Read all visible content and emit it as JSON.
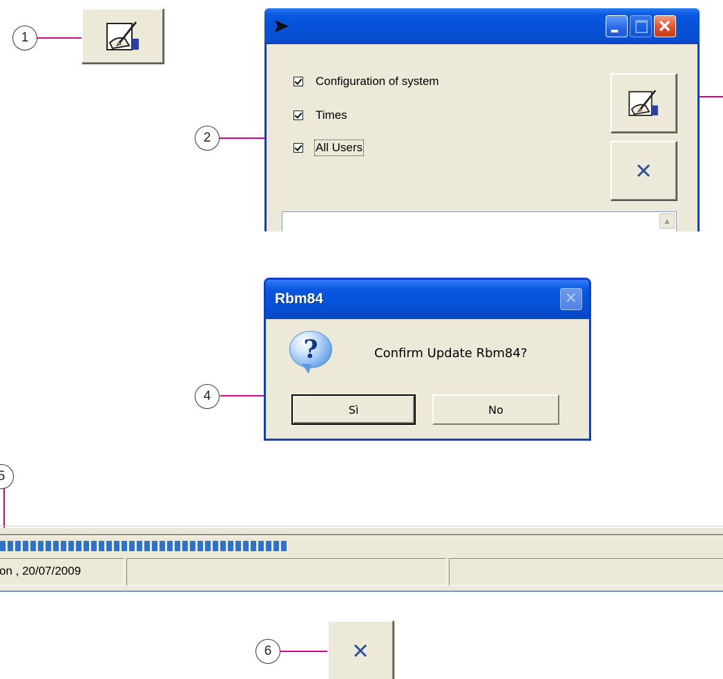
{
  "callouts": {
    "c1": "1",
    "c2": "2",
    "c4": "4",
    "c5": "5",
    "c6": "6"
  },
  "top_dialog": {
    "checkboxes": [
      {
        "label": "Configuration of system",
        "checked": true
      },
      {
        "label": "Times",
        "checked": true
      },
      {
        "label": "All Users",
        "checked": true
      }
    ],
    "buttons": {
      "write_icon": "write-icon",
      "cancel_icon": "cancel-x-icon"
    }
  },
  "confirm_dialog": {
    "title": "Rbm84",
    "message": "Confirm Update Rbm84?",
    "yes_label": "Sì",
    "no_label": "No"
  },
  "status_bar": {
    "progress_fraction": 0.4,
    "panel1_text": "on , 20/07/2009",
    "panel2_text": "",
    "panel3_text": ""
  },
  "colors": {
    "callout_line": "#d4008a",
    "xp_title_blue": "#0552d8",
    "face": "#ece9d8",
    "progress_blue": "#2f72c9"
  }
}
